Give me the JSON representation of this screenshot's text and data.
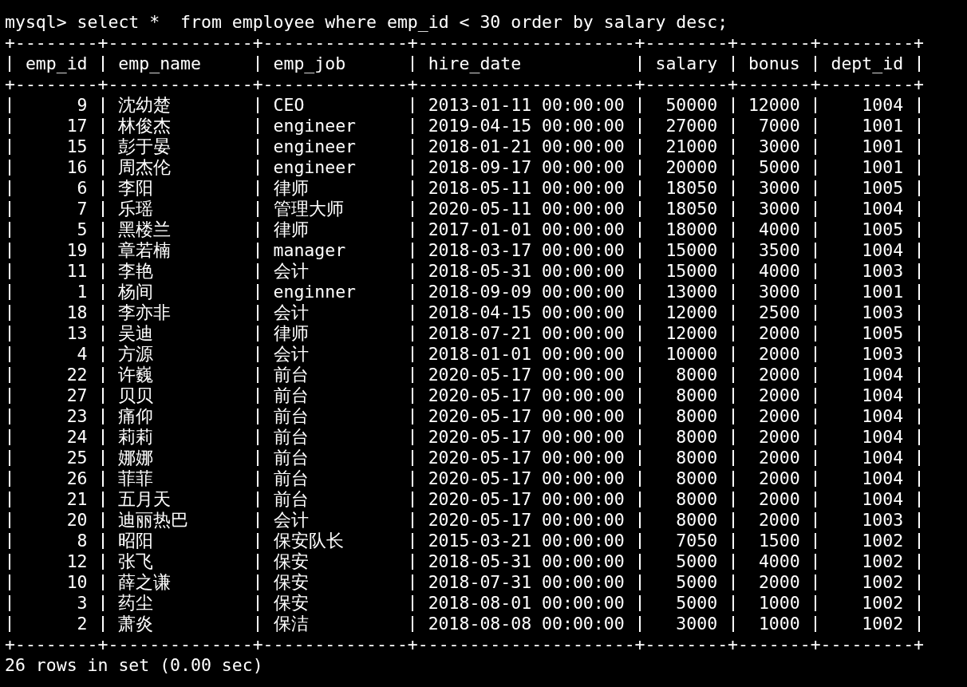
{
  "terminal": {
    "command_line": "mysql> select *  from employee where emp_id < 30 order by salary desc;",
    "separators": [
      "+--------+--------------+--------------+---------------------+--------+-------+---------+",
      "+--------+--------------+--------------+---------------------+--------+-------+---------+",
      "+--------+--------------+--------------+---------------------+--------+-------+---------+"
    ],
    "columns": [
      {
        "name": "emp_id"
      },
      {
        "name": "emp_name"
      },
      {
        "name": "emp_job"
      },
      {
        "name": "hire_date"
      },
      {
        "name": "salary"
      },
      {
        "name": "bonus"
      },
      {
        "name": "dept_id"
      }
    ],
    "rows": [
      [
        "9",
        "沈幼楚",
        "CEO",
        "2013-01-11 00:00:00",
        "50000",
        "12000",
        "1004"
      ],
      [
        "17",
        "林俊杰",
        "engineer",
        "2019-04-15 00:00:00",
        "27000",
        "7000",
        "1001"
      ],
      [
        "15",
        "彭于晏",
        "engineer",
        "2018-01-21 00:00:00",
        "21000",
        "3000",
        "1001"
      ],
      [
        "16",
        "周杰伦",
        "engineer",
        "2018-09-17 00:00:00",
        "20000",
        "5000",
        "1001"
      ],
      [
        "6",
        "李阳",
        "律师",
        "2018-05-11 00:00:00",
        "18050",
        "3000",
        "1005"
      ],
      [
        "7",
        "乐瑶",
        "管理大师",
        "2020-05-11 00:00:00",
        "18050",
        "3000",
        "1004"
      ],
      [
        "5",
        "黑楼兰",
        "律师",
        "2017-01-01 00:00:00",
        "18000",
        "4000",
        "1005"
      ],
      [
        "19",
        "章若楠",
        "manager",
        "2018-03-17 00:00:00",
        "15000",
        "3500",
        "1004"
      ],
      [
        "11",
        "李艳",
        "会计",
        "2018-05-31 00:00:00",
        "15000",
        "4000",
        "1003"
      ],
      [
        "1",
        "杨间",
        "enginner",
        "2018-09-09 00:00:00",
        "13000",
        "3000",
        "1001"
      ],
      [
        "18",
        "李亦非",
        "会计",
        "2018-04-15 00:00:00",
        "12000",
        "2500",
        "1003"
      ],
      [
        "13",
        "吴迪",
        "律师",
        "2018-07-21 00:00:00",
        "12000",
        "2000",
        "1005"
      ],
      [
        "4",
        "方源",
        "会计",
        "2018-01-01 00:00:00",
        "10000",
        "2000",
        "1003"
      ],
      [
        "22",
        "许巍",
        "前台",
        "2020-05-17 00:00:00",
        "8000",
        "2000",
        "1004"
      ],
      [
        "27",
        "贝贝",
        "前台",
        "2020-05-17 00:00:00",
        "8000",
        "2000",
        "1004"
      ],
      [
        "23",
        "痛仰",
        "前台",
        "2020-05-17 00:00:00",
        "8000",
        "2000",
        "1004"
      ],
      [
        "24",
        "莉莉",
        "前台",
        "2020-05-17 00:00:00",
        "8000",
        "2000",
        "1004"
      ],
      [
        "25",
        "娜娜",
        "前台",
        "2020-05-17 00:00:00",
        "8000",
        "2000",
        "1004"
      ],
      [
        "26",
        "菲菲",
        "前台",
        "2020-05-17 00:00:00",
        "8000",
        "2000",
        "1004"
      ],
      [
        "21",
        "五月天",
        "前台",
        "2020-05-17 00:00:00",
        "8000",
        "2000",
        "1004"
      ],
      [
        "20",
        "迪丽热巴",
        "会计",
        "2020-05-17 00:00:00",
        "8000",
        "2000",
        "1003"
      ],
      [
        "8",
        "昭阳",
        "保安队长",
        "2015-03-21 00:00:00",
        "7050",
        "1500",
        "1002"
      ],
      [
        "12",
        "张飞",
        "保安",
        "2018-05-31 00:00:00",
        "5000",
        "4000",
        "1002"
      ],
      [
        "10",
        "薛之谦",
        "保安",
        "2018-07-31 00:00:00",
        "5000",
        "2000",
        "1002"
      ],
      [
        "3",
        "药尘",
        "保安",
        "2018-08-01 00:00:00",
        "5000",
        "1000",
        "1002"
      ],
      [
        "2",
        "萧炎",
        "保洁",
        "2018-08-08 00:00:00",
        "3000",
        "1000",
        "1002"
      ]
    ],
    "summary": "26 rows in set (0.00 sec)"
  }
}
